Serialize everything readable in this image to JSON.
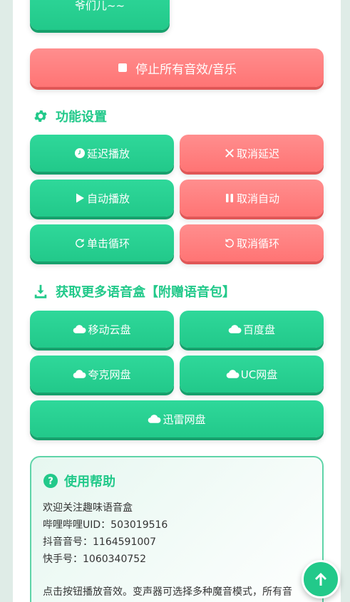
{
  "top_button": {
    "label": "爷们儿~~"
  },
  "stop_all": {
    "label": "停止所有音效/音乐"
  },
  "settings": {
    "title": "功能设置",
    "delay_play": "延迟播放",
    "cancel_delay": "取消延迟",
    "auto_play": "自动播放",
    "cancel_auto": "取消自动",
    "single_loop": "单击循环",
    "cancel_loop": "取消循环"
  },
  "downloads": {
    "title": "获取更多语音盒【附赠语音包】",
    "mobile_cloud": "移动云盘",
    "baidu": "百度盘",
    "quark": "夸克网盘",
    "uc": "UC网盘",
    "xunlei": "迅雷网盘"
  },
  "help": {
    "title": "使用帮助",
    "lines": [
      "欢迎关注趣味语音盒",
      "哔哩哔哩UID：503019516",
      "抖音音号：1164591007",
      "快手号：1060340752",
      "",
      "点击按钮播放音效。变声器可选择多种魔音模式，所有音"
    ]
  },
  "colors": {
    "accent": "#22c98a",
    "danger": "#ff7a7a",
    "background": "#dfece7"
  },
  "icons": {
    "stop": "stop-icon",
    "settings": "gear-icon",
    "download": "download-icon",
    "clock": "clock-icon",
    "close": "close-icon",
    "play": "play-icon",
    "pause": "pause-icon",
    "redo": "redo-icon",
    "undo": "undo-icon",
    "cloud": "cloud-icon",
    "help": "question-circle-icon",
    "back_to_top": "arrow-up-icon"
  }
}
